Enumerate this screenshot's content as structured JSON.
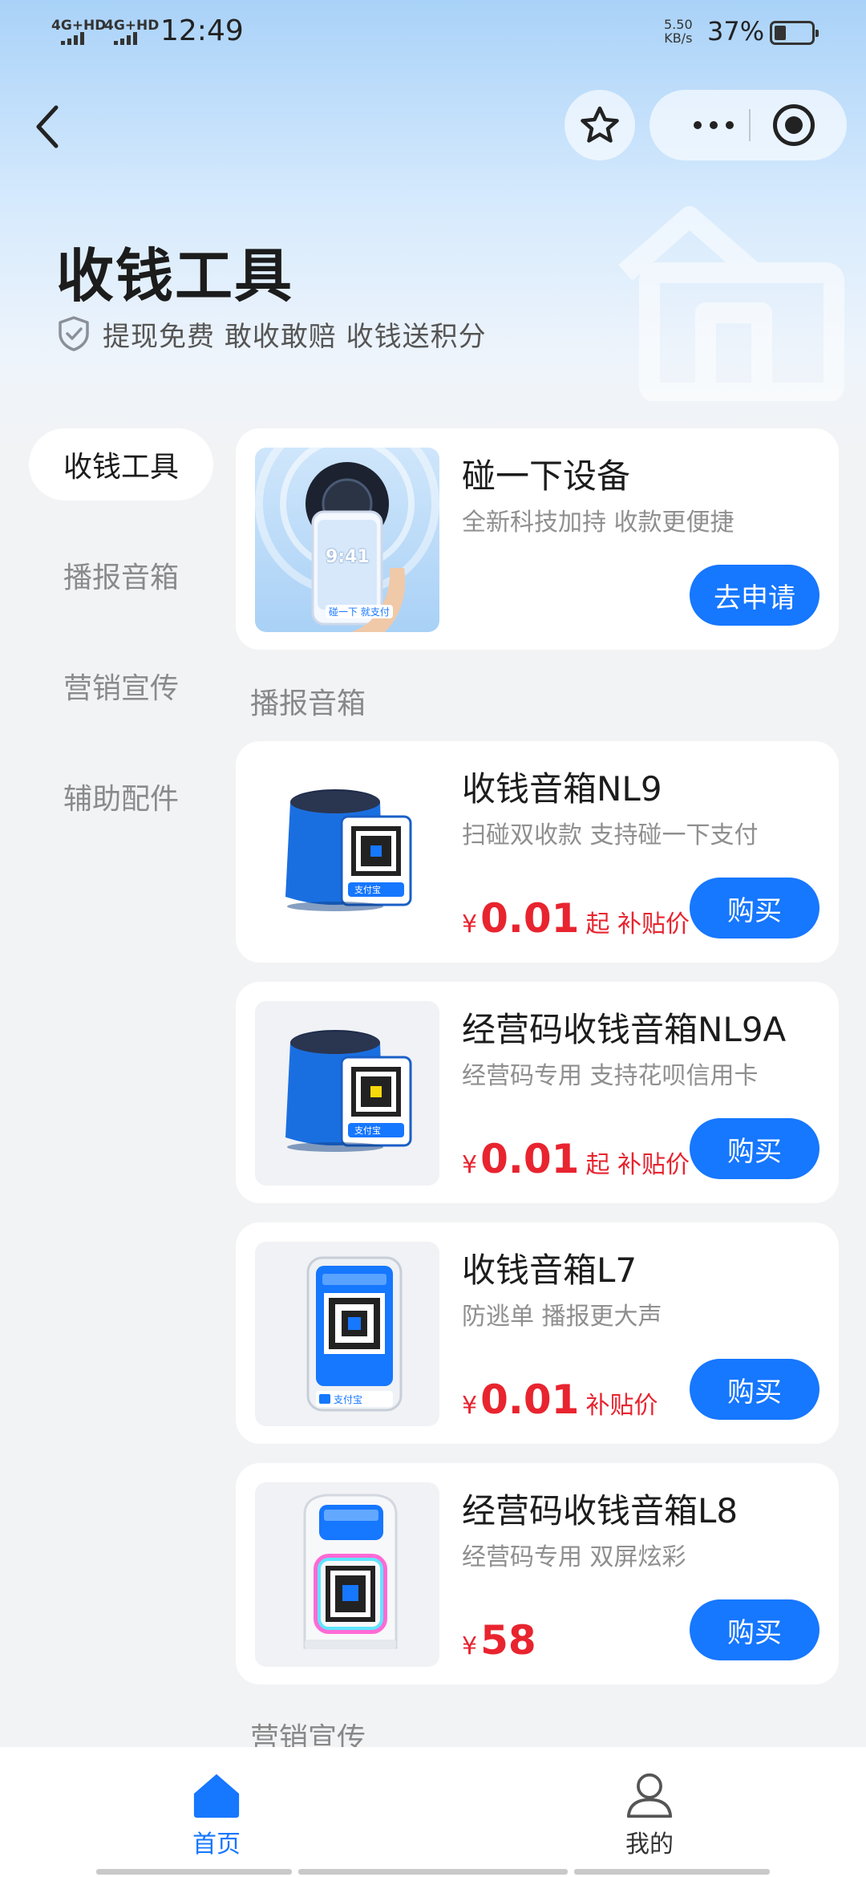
{
  "status_bar": {
    "signal1": "4G+HD",
    "signal2": "4G+HD",
    "time": "12:49",
    "net_speed_value": "5.50",
    "net_speed_unit": "KB/s",
    "battery": "37%"
  },
  "hero": {
    "title": "收钱工具",
    "subtitle": "提现免费 敢收敢赔 收钱送积分"
  },
  "sidebar": {
    "items": [
      {
        "label": "收钱工具",
        "active": true
      },
      {
        "label": "播报音箱",
        "active": false
      },
      {
        "label": "营销宣传",
        "active": false
      },
      {
        "label": "辅助配件",
        "active": false
      }
    ]
  },
  "featured": {
    "title": "碰一下设备",
    "subtitle": "全新科技加持 收款更便捷",
    "cta": "去申请",
    "phone_time": "9:41",
    "phone_caption": "碰一下 就支付"
  },
  "section_speaker": "播报音箱",
  "products": [
    {
      "title": "收钱音箱NL9",
      "subtitle": "扫碰双收款 支持碰一下支付",
      "currency": "¥",
      "price": "0.01",
      "tag": "起 补贴价",
      "cta": "购买"
    },
    {
      "title": "经营码收钱音箱NL9A",
      "subtitle": "经营码专用 支持花呗信用卡",
      "currency": "¥",
      "price": "0.01",
      "tag": "起 补贴价",
      "cta": "购买"
    },
    {
      "title": "收钱音箱L7",
      "subtitle": "防逃单 播报更大声",
      "currency": "¥",
      "price": "0.01",
      "tag": "补贴价",
      "cta": "购买"
    },
    {
      "title": "经营码收钱音箱L8",
      "subtitle": "经营码专用 双屏炫彩",
      "currency": "¥",
      "price": "58",
      "tag": "",
      "cta": "购买"
    }
  ],
  "product_brand": "支付宝",
  "section_marketing": "营销宣传",
  "tabbar": {
    "home": "首页",
    "mine": "我的"
  },
  "colors": {
    "accent": "#1677ff",
    "price": "#e8242f",
    "title": "#1c1c1c",
    "muted": "#8f8f8f"
  },
  "icons": [
    "back-arrow-icon",
    "star-icon",
    "more-icon",
    "target-icon",
    "shield-check-icon",
    "home-icon",
    "user-icon"
  ]
}
